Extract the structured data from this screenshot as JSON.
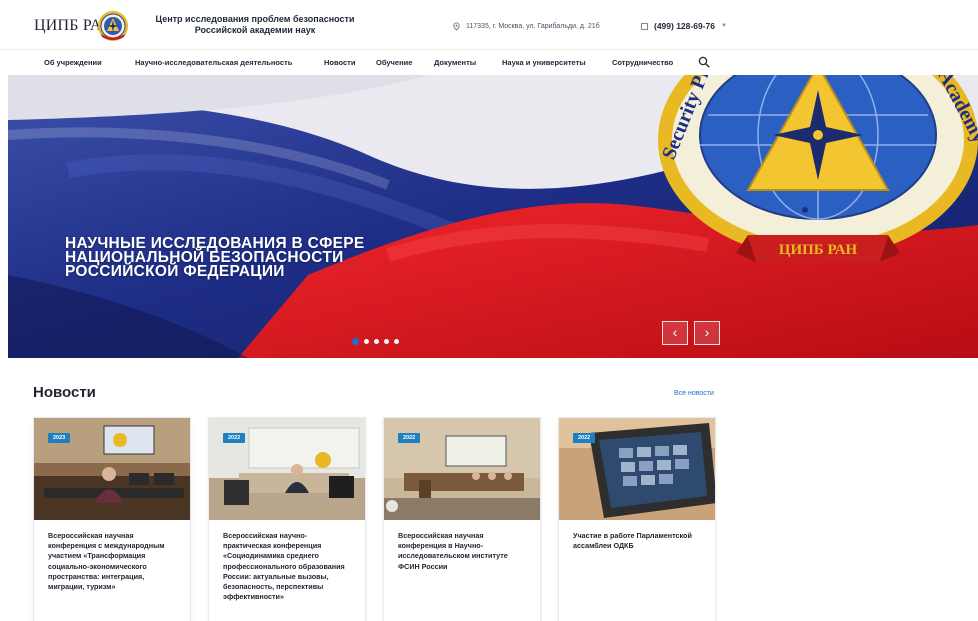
{
  "header": {
    "logo_text": "ЦИПБ РАН",
    "org_name_line1": "Центр исследования проблем безопасности",
    "org_name_line2": "Российской академии наук",
    "address": "117335, г. Москва, ул. Гарибальди, д. 21б",
    "phone": "(499) 128-69-76",
    "icons": {
      "address": "location-pin-icon",
      "phone": "phone-icon",
      "phone_caret": "chevron-down-icon"
    }
  },
  "nav": {
    "items": [
      {
        "label": "Об учреждении"
      },
      {
        "label": "Научно-исследовательская деятельность"
      },
      {
        "label": "Новости"
      },
      {
        "label": "Обучение"
      },
      {
        "label": "Документы"
      },
      {
        "label": "Наука и университеты"
      },
      {
        "label": "Сотрудничество"
      }
    ],
    "search_icon": "search-icon"
  },
  "hero": {
    "title": "НАУЧНЫЕ ИССЛЕДОВАНИЯ В СФЕРЕ НАЦИОНАЛЬНОЙ БЕЗОПАСНОСТИ РОССИЙСКОЙ ФЕДЕРАЦИИ",
    "emblem_text_left": "Security Problem",
    "emblem_text_right": "Academy of Science",
    "ribbon_text": "ЦИПБ РАН",
    "slides_count": 5,
    "active_slide": 1,
    "prev_icon": "chevron-left-icon",
    "next_icon": "chevron-right-icon",
    "prev_glyph": "‹",
    "next_glyph": "›",
    "colors": {
      "blue": "#1f2f8c",
      "red": "#e0151f",
      "gold": "#e8b923"
    }
  },
  "news": {
    "title": "Новости",
    "all_link": "Все новости",
    "items": [
      {
        "year": "2023",
        "text": "Всероссийская научная конференция с международным участием «Трансформация социально-экономического пространства: интеграция, миграции, туризм»"
      },
      {
        "year": "2022",
        "text": "Всероссийская научно-практическая конференция «Социодинамика среднего профессионального образования России: актуальные вызовы, безопасность, перспективы эффективности»"
      },
      {
        "year": "2022",
        "text": "Всероссийская научная конференция в Научно-исследовательском институте ФСИН России"
      },
      {
        "year": "2022",
        "text": "Участие в работе Парламентской ассамблеи ОДКБ"
      }
    ]
  },
  "colors": {
    "accent": "#1e6fd0",
    "badge": "#1f7fc0",
    "text": "#1f2430"
  }
}
